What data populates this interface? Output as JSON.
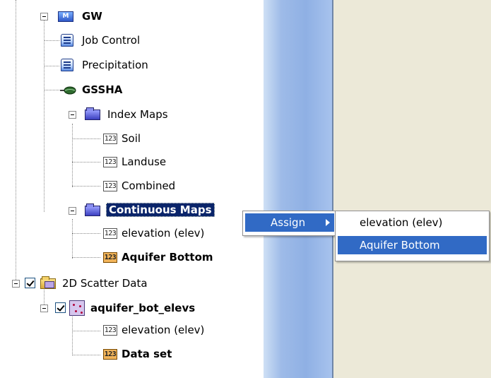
{
  "tree": {
    "gw": {
      "label": "GW",
      "icon": "model-folder-icon"
    },
    "job_control": {
      "label": "Job Control",
      "icon": "document-icon"
    },
    "precipitation": {
      "label": "Precipitation",
      "icon": "document-icon"
    },
    "gssha": {
      "label": "GSSHA",
      "icon": "gssha-leaf-icon"
    },
    "index_maps": {
      "label": "Index Maps",
      "icon": "folder-icon",
      "children": [
        {
          "label": "Soil",
          "icon_text": "123"
        },
        {
          "label": "Landuse",
          "icon_text": "123"
        },
        {
          "label": "Combined",
          "icon_text": "123"
        }
      ]
    },
    "continuous_maps": {
      "label": "Continuous Maps",
      "icon": "folder-icon",
      "selected": true,
      "children": [
        {
          "label": "elevation (elev)",
          "icon_text": "123"
        },
        {
          "label": "Aquifer Bottom",
          "icon_text": "123",
          "bold": true
        }
      ]
    },
    "scatter_data": {
      "label": "2D Scatter Data",
      "checked": true,
      "icon": "scatter-folder-icon",
      "set": {
        "label": "aquifer_bot_elevs",
        "checked": true,
        "icon": "scatter-set-icon",
        "children": [
          {
            "label": "elevation (elev)",
            "icon_text": "123"
          },
          {
            "label": "Data set",
            "icon_text": "123",
            "bold": true
          }
        ]
      }
    }
  },
  "context_menu": {
    "items": [
      {
        "label": "Assign",
        "has_submenu": true,
        "highlighted": true
      }
    ]
  },
  "submenu": {
    "items": [
      {
        "label": "elevation (elev)",
        "highlighted": false
      },
      {
        "label": "Aquifer Bottom",
        "highlighted": true
      }
    ]
  },
  "colors": {
    "selection": "#0a246a",
    "menu_highlight": "#316ac5",
    "panel": "#ece9d8"
  }
}
